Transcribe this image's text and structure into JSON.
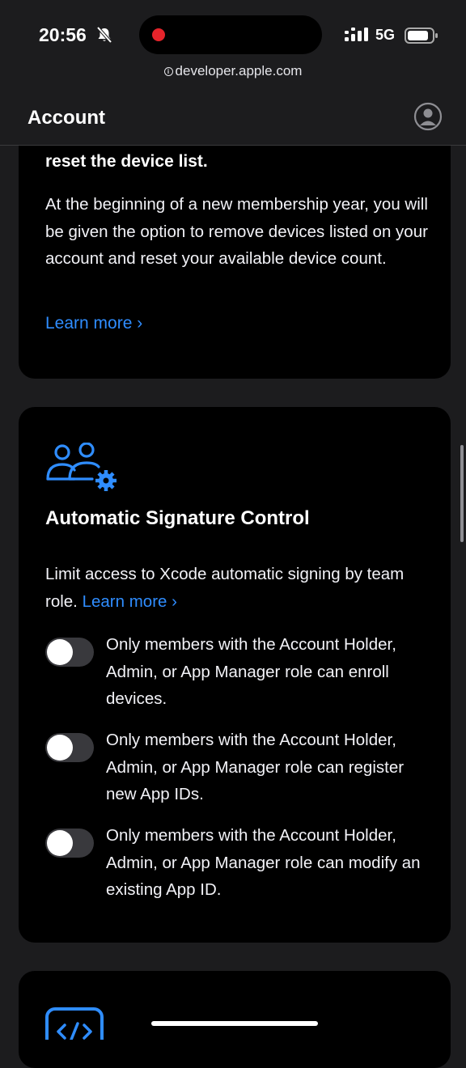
{
  "status_bar": {
    "time": "20:56",
    "network": "5G"
  },
  "browser": {
    "url": "developer.apple.com"
  },
  "header": {
    "title": "Account"
  },
  "device_reset_card": {
    "heading_fragment": "reset the device list.",
    "body": "At the beginning of a new membership year, you will be given the option to remove devices listed on your account and reset your available device count.",
    "link_label": "Learn more ›"
  },
  "signature_card": {
    "title": "Automatic Signature Control",
    "description": "Limit access to Xcode automatic signing by team role.",
    "link_label": "Learn more ›",
    "toggles": [
      {
        "label": "Only members with the Account Holder, Admin, or App Manager role can enroll devices.",
        "on": false
      },
      {
        "label": "Only members with the Account Holder, Admin, or App Manager role can register new App IDs.",
        "on": false
      },
      {
        "label": "Only members with the Account Holder, Admin, or App Manager role can modify an existing App ID.",
        "on": false
      }
    ]
  },
  "colors": {
    "link": "#2f8dff",
    "card_bg": "#000000",
    "page_bg": "#1c1c1e"
  },
  "icons": [
    "bell-slash-icon",
    "signal-icon",
    "battery-icon",
    "info-icon",
    "profile-icon",
    "group-gear-icon",
    "code-icon"
  ]
}
